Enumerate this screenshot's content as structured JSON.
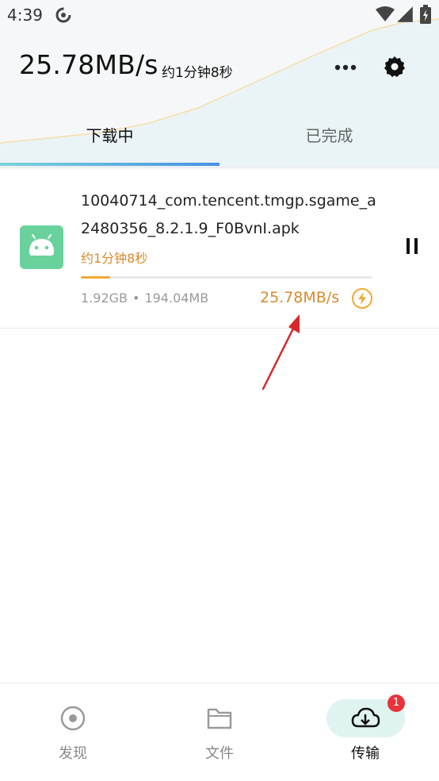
{
  "status_bar": {
    "time": "4:39"
  },
  "header": {
    "speed": "25.78MB/s",
    "eta": "约1分钟8秒",
    "more_icon": "more-icon",
    "settings_icon": "gear-icon"
  },
  "tabs": [
    {
      "label": "下载中",
      "active": true
    },
    {
      "label": "已完成",
      "active": false
    }
  ],
  "download": {
    "filename": "10040714_com.tencent.tmgp.sgame_a2480356_8.2.1.9_F0BvnI.apk",
    "eta": "约1分钟8秒",
    "progress_fraction": 0.1,
    "total_size": "1.92GB",
    "separator": "•",
    "downloaded": "194.04MB",
    "speed": "25.78MB/s",
    "app_icon": "android-icon",
    "accelerate_icon": "lightning-bolt-icon",
    "pause_icon": "pause-icon"
  },
  "bottom_nav": [
    {
      "label": "发现",
      "icon": "discover-icon",
      "active": false
    },
    {
      "label": "文件",
      "icon": "folder-icon",
      "active": false
    },
    {
      "label": "传输",
      "icon": "cloud-download-icon",
      "active": true,
      "badge": "1"
    }
  ],
  "colors": {
    "accent_orange": "#d9892b",
    "progress": "#f3a835",
    "tab_gradient_start": "#7ed3d8",
    "tab_gradient_end": "#4a90e2",
    "active_pill": "#dff3f1",
    "badge": "#e8333a",
    "android_green": "#69d29c"
  }
}
